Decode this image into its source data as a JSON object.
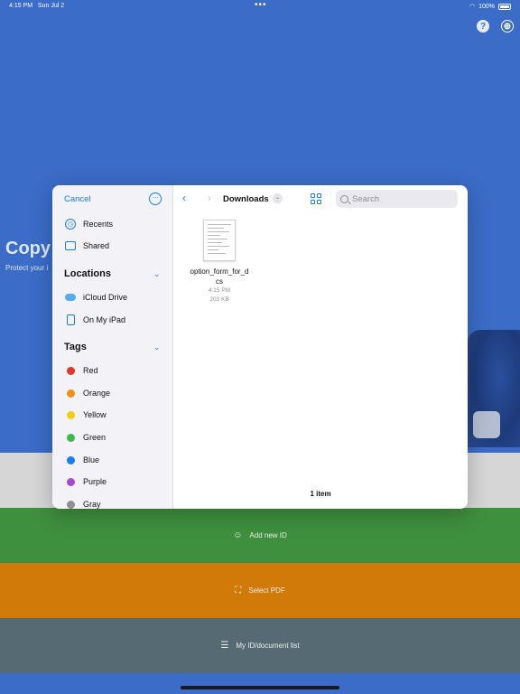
{
  "status_bar": {
    "time": "4:15 PM",
    "date": "Sun Jul 2",
    "battery": "100%"
  },
  "background": {
    "title": "Copy",
    "subtitle": "Protect your i",
    "help_icon": "question-circle-icon",
    "globe_icon": "globe-icon"
  },
  "bottom_buttons": {
    "add_new_id": "Add new ID",
    "select_pdf": "Select PDF",
    "document_list": "My ID/document list"
  },
  "picker": {
    "cancel_label": "Cancel",
    "sidebar": {
      "recents": "Recents",
      "shared": "Shared",
      "locations_heading": "Locations",
      "locations": [
        "iCloud Drive",
        "On My iPad"
      ],
      "tags_heading": "Tags",
      "tags": [
        {
          "label": "Red",
          "color": "#e5352b"
        },
        {
          "label": "Orange",
          "color": "#f2900f"
        },
        {
          "label": "Yellow",
          "color": "#f5cc0c"
        },
        {
          "label": "Green",
          "color": "#3cba4a"
        },
        {
          "label": "Blue",
          "color": "#1a7cf5"
        },
        {
          "label": "Purple",
          "color": "#a54ad4"
        },
        {
          "label": "Gray",
          "color": "#8e8e93"
        }
      ]
    },
    "folder_title": "Downloads",
    "search_placeholder": "Search",
    "files": [
      {
        "name": "option_form_for_dcs",
        "time": "4:15 PM",
        "size": "203 KB"
      }
    ],
    "item_count": "1 item"
  },
  "colors": {
    "accent": "#1a7cf5",
    "background": "#3a6cc8",
    "green_band": "#3e8f3e",
    "orange_band": "#d17a0a",
    "slate_band": "#556a73"
  }
}
